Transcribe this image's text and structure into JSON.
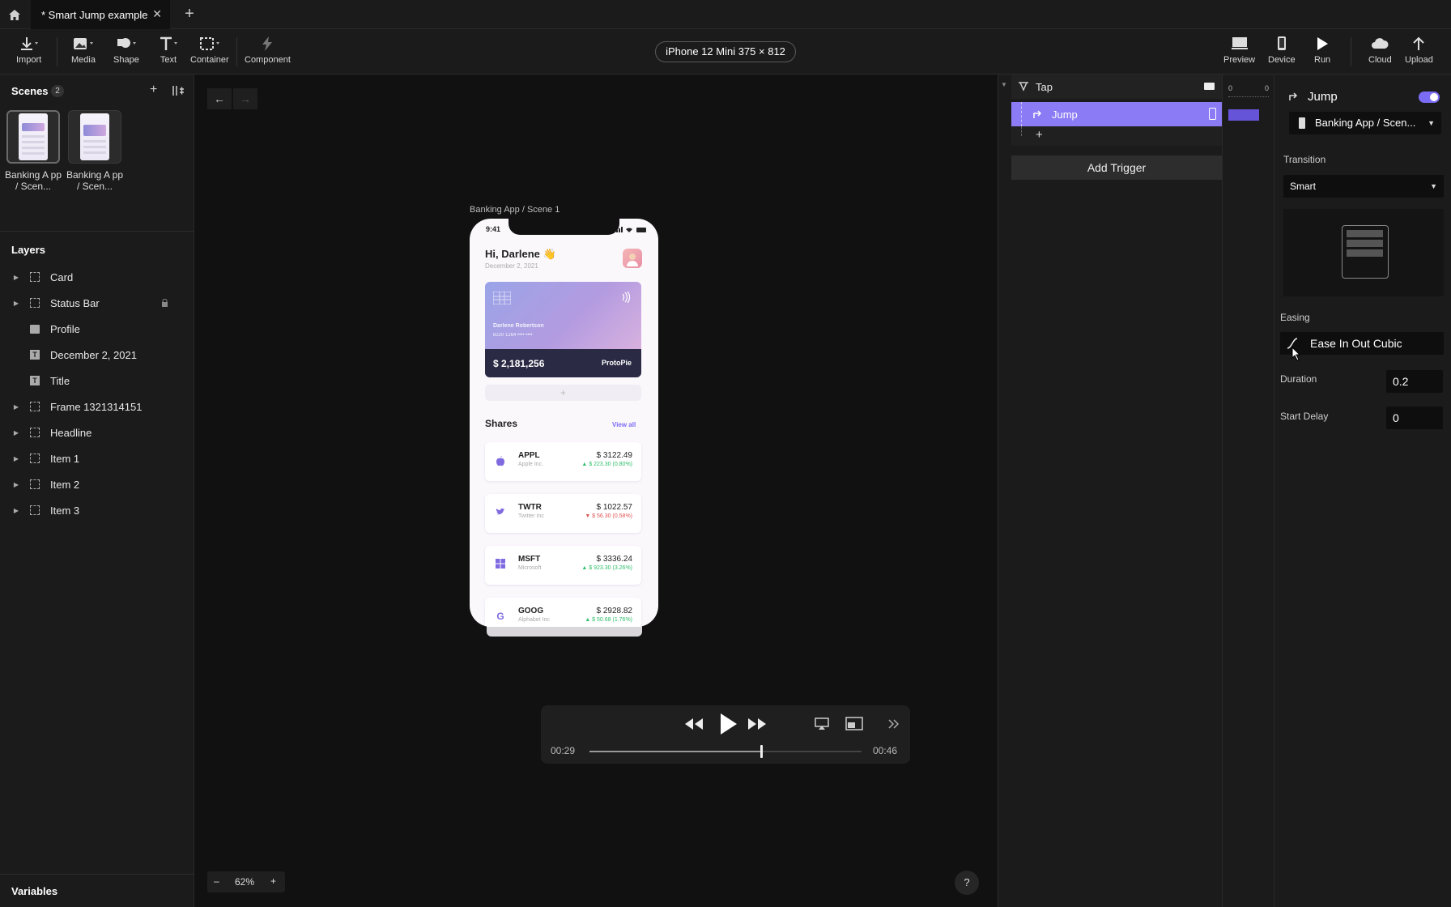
{
  "tabs": {
    "active_title": "* Smart Jump example",
    "close": "✕",
    "add": "+"
  },
  "toolbar": {
    "import": "Import",
    "media": "Media",
    "shape": "Shape",
    "text": "Text",
    "container": "Container",
    "component": "Component",
    "device": "iPhone 12 Mini  375 × 812",
    "preview": "Preview",
    "device_btn": "Device",
    "run": "Run",
    "cloud": "Cloud",
    "upload": "Upload"
  },
  "scenes": {
    "title": "Scenes",
    "count": "2",
    "items": [
      {
        "label": "Banking A pp / Scen..."
      },
      {
        "label": "Banking A pp / Scen..."
      }
    ]
  },
  "layers": {
    "title": "Layers",
    "items": [
      {
        "label": "Card"
      },
      {
        "label": "Status Bar"
      },
      {
        "label": "Profile"
      },
      {
        "label": "December 2, 2021"
      },
      {
        "label": "Title"
      },
      {
        "label": "Frame 1321314151"
      },
      {
        "label": "Headline"
      },
      {
        "label": "Item 1"
      },
      {
        "label": "Item 2"
      },
      {
        "label": "Item 3"
      }
    ]
  },
  "variables": {
    "title": "Variables"
  },
  "canvas": {
    "scene_label": "Banking App / Scene 1",
    "zoom": "62%",
    "zoom_minus": "–",
    "zoom_plus": "+",
    "help": "?"
  },
  "phone": {
    "time": "9:41",
    "greeting": "Hi, Darlene 👋",
    "date": "December 2, 2021",
    "card_name": "Darlene Robertson",
    "card_number": "8220 1264 •••• ••••",
    "balance": "$ 2,181,256",
    "brand": "ProtoPie",
    "add": "+",
    "shares_title": "Shares",
    "view_all": "View all",
    "stocks": [
      {
        "ticker": "APPL",
        "name": "Apple Inc.",
        "price": "$ 3122.49",
        "change": "▲ $ 223.30 (0.80%)",
        "dir": "up"
      },
      {
        "ticker": "TWTR",
        "name": "Twitter Inc",
        "price": "$ 1022.57",
        "change": "▼ $ 56.30 (0.58%)",
        "dir": "down"
      },
      {
        "ticker": "MSFT",
        "name": "Microsoft",
        "price": "$ 3336.24",
        "change": "▲ $ 923.30 (3.26%)",
        "dir": "up"
      },
      {
        "ticker": "GOOG",
        "name": "Alphabet Inc",
        "price": "$ 2928.82",
        "change": "▲ $ 50.68 (1.76%)",
        "dir": "up"
      }
    ]
  },
  "player": {
    "current": "00:29",
    "total": "00:46",
    "progress": 0.63
  },
  "interactions": {
    "trigger": "Tap",
    "response": "Jump",
    "add": "+",
    "add_trigger": "Add Trigger",
    "ruler_a": "0",
    "ruler_b": "0"
  },
  "properties": {
    "title": "Jump",
    "target": "Banking App / Scen...",
    "transition_label": "Transition",
    "transition_value": "Smart",
    "easing_label": "Easing",
    "easing_value": "Ease In Out Cubic",
    "duration_label": "Duration",
    "duration_value": "0.2",
    "delay_label": "Start Delay",
    "delay_value": "0",
    "accent": "#7b6cf6"
  }
}
